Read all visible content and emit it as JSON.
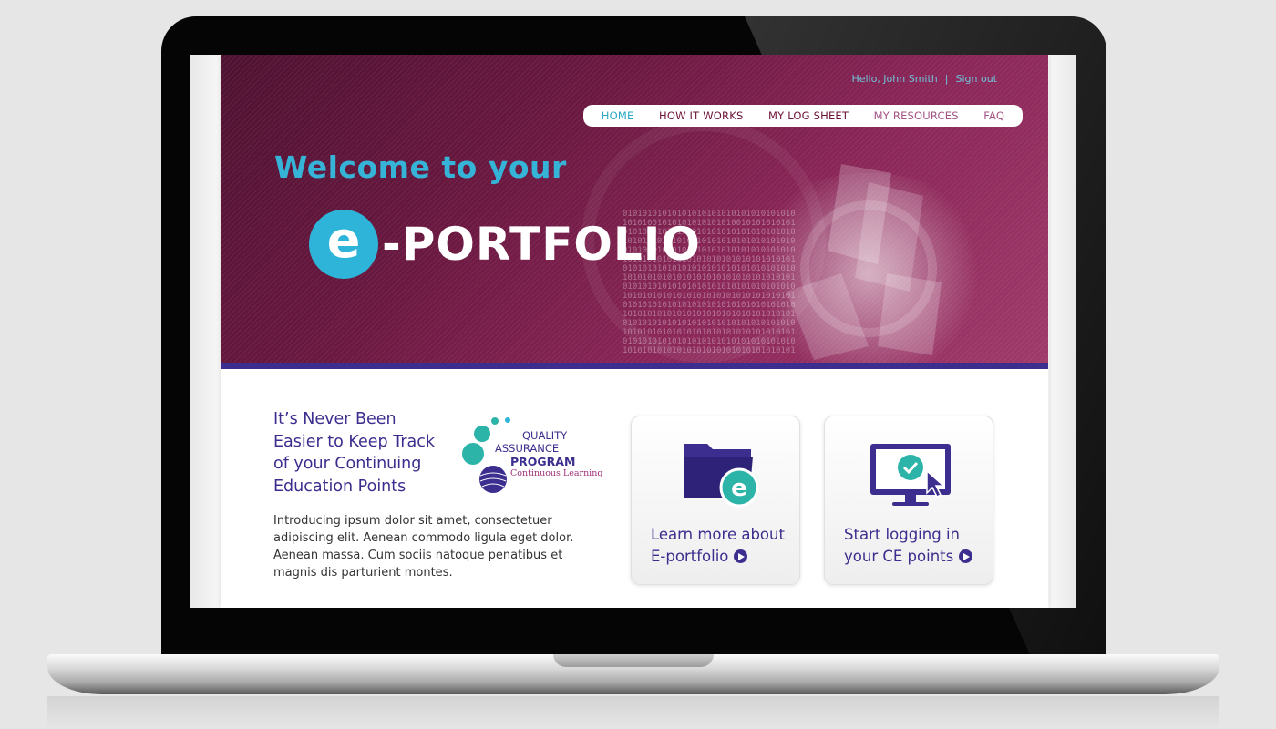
{
  "userbar": {
    "greeting": "Hello, John Smith",
    "separator": "|",
    "signout": "Sign out"
  },
  "nav": [
    {
      "label": "HOME",
      "active": true
    },
    {
      "label": "HOW IT WORKS"
    },
    {
      "label": "MY LOG SHEET"
    },
    {
      "label": "MY RESOURCES"
    },
    {
      "label": "FAQ"
    }
  ],
  "hero": {
    "welcome": "Welcome to your",
    "logo_letter": "e",
    "logo_text": "-PORTFOLIO",
    "binary": "01010101010101010101010101010101010\n10101001010101010101010010101010101\n01010101010101010101010101010101010\n10101010101010010101010101010101010\n01010101010101010101010101010101010\n10101010101010101010101010101010101\n01010101010101010101010101010101010\n10101010101010101010101010101010101\n01010101010101010101010101010101010\n10101010101010101010101010101010101\n01010101010101010101010101010101010\n10101010101010101010101010101010101\n01010101010101010101010101010101010\n10101010101010101010101010101010101\n01010101010101010101010101010101010\n10101010101010101010101010101010101"
  },
  "intro": {
    "heading": "It’s Never Been Easier to Keep Track of your Continuing Education Points",
    "body": "Introducing ipsum dolor sit amet, consectetuer adipiscing elit. Aenean commodo ligula eget dolor. Aenean massa. Cum sociis natoque penatibus et magnis dis parturient montes."
  },
  "qa_logo": {
    "line1": "QUALITY",
    "line2": "ASSURANCE",
    "line3": "PROGRAM",
    "line4": "Continuous Learning"
  },
  "cards": [
    {
      "line1": "Learn more about",
      "line2": "E-portfolio",
      "icon": "folder-e-icon"
    },
    {
      "line1": "Start logging in",
      "line2": "your CE points",
      "icon": "monitor-check-icon"
    }
  ],
  "colors": {
    "brand_purple": "#3b2e8e",
    "accent_teal": "#2db4d8",
    "hero_magenta": "#6a1840"
  }
}
